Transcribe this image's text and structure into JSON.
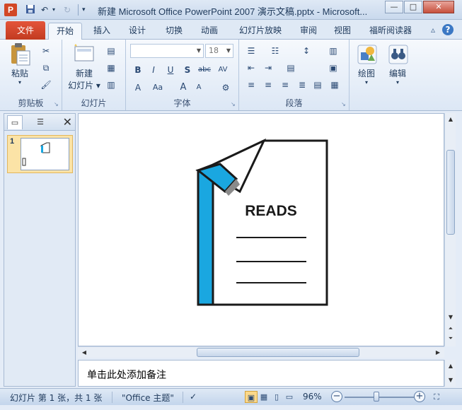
{
  "window": {
    "title": "新建 Microsoft Office PowerPoint 2007 演示文稿.pptx - Microsoft...",
    "app_icon": "P",
    "minimize": "—",
    "maximize": "□",
    "close": "✕"
  },
  "tabs": [
    {
      "label": "文件"
    },
    {
      "label": "开始"
    },
    {
      "label": "插入"
    },
    {
      "label": "设计"
    },
    {
      "label": "切换"
    },
    {
      "label": "动画"
    },
    {
      "label": "幻灯片放映"
    },
    {
      "label": "审阅"
    },
    {
      "label": "视图"
    },
    {
      "label": "福昕阅读器"
    }
  ],
  "ribbon": {
    "clipboard": {
      "group": "剪贴板",
      "paste": "粘贴"
    },
    "slides": {
      "group": "幻灯片",
      "new_slide_line1": "新建",
      "new_slide_line2": "幻灯片"
    },
    "font": {
      "group": "字体",
      "font_name": "",
      "font_size": "18",
      "bold": "B",
      "italic": "I",
      "underline": "U",
      "shadow": "S",
      "strike": "abc",
      "spacing": "AV",
      "case": "Aa",
      "grow": "A",
      "shrink": "A"
    },
    "paragraph": {
      "group": "段落"
    },
    "drawing": {
      "label": "绘图"
    },
    "editing": {
      "label": "编辑"
    }
  },
  "thumbnails": {
    "slide_number": "1"
  },
  "slide": {
    "doc_text": "READS"
  },
  "notes": {
    "placeholder": "单击此处添加备注"
  },
  "status": {
    "slide_info": "幻灯片 第 1 张，共 1 张",
    "theme": "\"Office 主题\"",
    "zoom": "96%",
    "zoom_level_percent": 96
  },
  "colors": {
    "file_tab": "#c23b21",
    "doc_stripe": "#1aa7e0",
    "accent": "#1e395b"
  }
}
